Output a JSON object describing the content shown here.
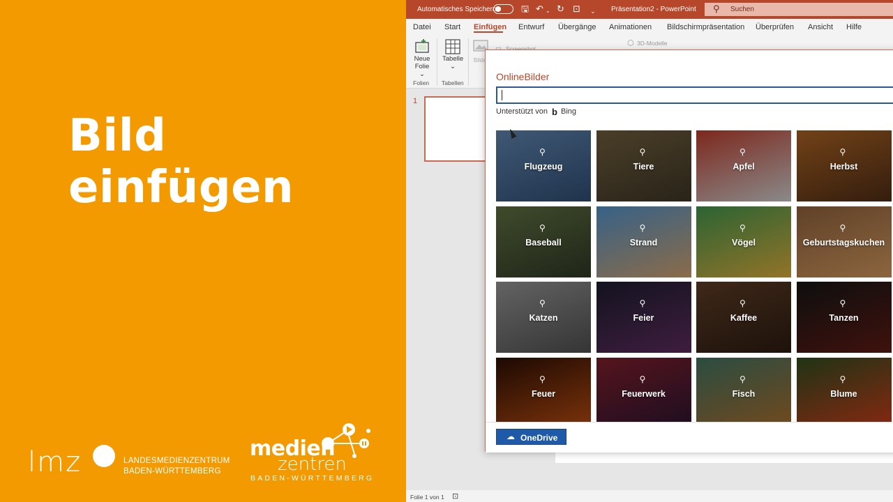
{
  "left_panel": {
    "title": "Bild einfügen",
    "lmz_logo": "lmz",
    "lmz_line1": "LANDESMEDIENZENTRUM",
    "lmz_line2": "BADEN-WÜRTTEMBERG",
    "mz_line1": "medien",
    "mz_line2": "zentren",
    "mz_line3": "BADEN-WÜRTTEMBERG",
    "background": "#f39a00"
  },
  "titlebar": {
    "autosave_label": "Automatisches Speichern",
    "document_title": "Präsentation2  -  PowerPoint",
    "search_placeholder": "Suchen",
    "accent": "#b7472a"
  },
  "menu": {
    "tabs": [
      "Datei",
      "Start",
      "Einfügen",
      "Entwurf",
      "Übergänge",
      "Animationen",
      "Bildschirmpräsentation",
      "Überprüfen",
      "Ansicht",
      "Hilfe"
    ],
    "active": "Einfügen"
  },
  "ribbon": {
    "new_slide_line1": "Neue",
    "new_slide_line2": "Folie",
    "table_label": "Tabelle",
    "group_slides": "Folien",
    "group_tables": "Tabellen",
    "images_label": "Bilder",
    "screenshot_label": "Screenshot",
    "models_label": "3D-Modelle"
  },
  "thumbnail": {
    "number": "1"
  },
  "dialog": {
    "title": "OnlineBilder",
    "search_value": "",
    "powered_by": "Unterstützt von",
    "bing_label": "Bing",
    "onedrive_label": "OneDrive",
    "tiles": [
      {
        "label": "Flugzeug",
        "colors": [
          "#5c7fa8",
          "#2e4a6e"
        ]
      },
      {
        "label": "Tiere",
        "colors": [
          "#6b5a3a",
          "#3b3324"
        ]
      },
      {
        "label": "Apfel",
        "colors": [
          "#b33a2a",
          "#c6c6c6"
        ]
      },
      {
        "label": "Herbst",
        "colors": [
          "#a35f22",
          "#4b2a14"
        ]
      },
      {
        "label": "Baseball",
        "colors": [
          "#5b6b3f",
          "#2e3624"
        ]
      },
      {
        "label": "Strand",
        "colors": [
          "#4f8cc2",
          "#c79b6a"
        ]
      },
      {
        "label": "Vögel",
        "colors": [
          "#3f8f4a",
          "#d2a63a"
        ]
      },
      {
        "label": "Geburtstagskuchen",
        "colors": [
          "#8a5e3a",
          "#c9925a"
        ]
      },
      {
        "label": "Katzen",
        "colors": [
          "#8e8e8e",
          "#4c4c4c"
        ]
      },
      {
        "label": "Feier",
        "colors": [
          "#1c1c2e",
          "#5a2a5a"
        ]
      },
      {
        "label": "Kaffee",
        "colors": [
          "#5a3a24",
          "#2a1a10"
        ]
      },
      {
        "label": "Tanzen",
        "colors": [
          "#151515",
          "#5a1a14"
        ]
      },
      {
        "label": "Feuer",
        "colors": [
          "#2a0e05",
          "#b34a10"
        ]
      },
      {
        "label": "Feuerwerk",
        "colors": [
          "#7a1e2a",
          "#2a1430"
        ]
      },
      {
        "label": "Fisch",
        "colors": [
          "#3e6e5e",
          "#a3692a"
        ]
      },
      {
        "label": "Blume",
        "colors": [
          "#2e4a1e",
          "#c23a1a"
        ]
      }
    ]
  },
  "status": {
    "slide_info": "Folie 1 von 1"
  }
}
